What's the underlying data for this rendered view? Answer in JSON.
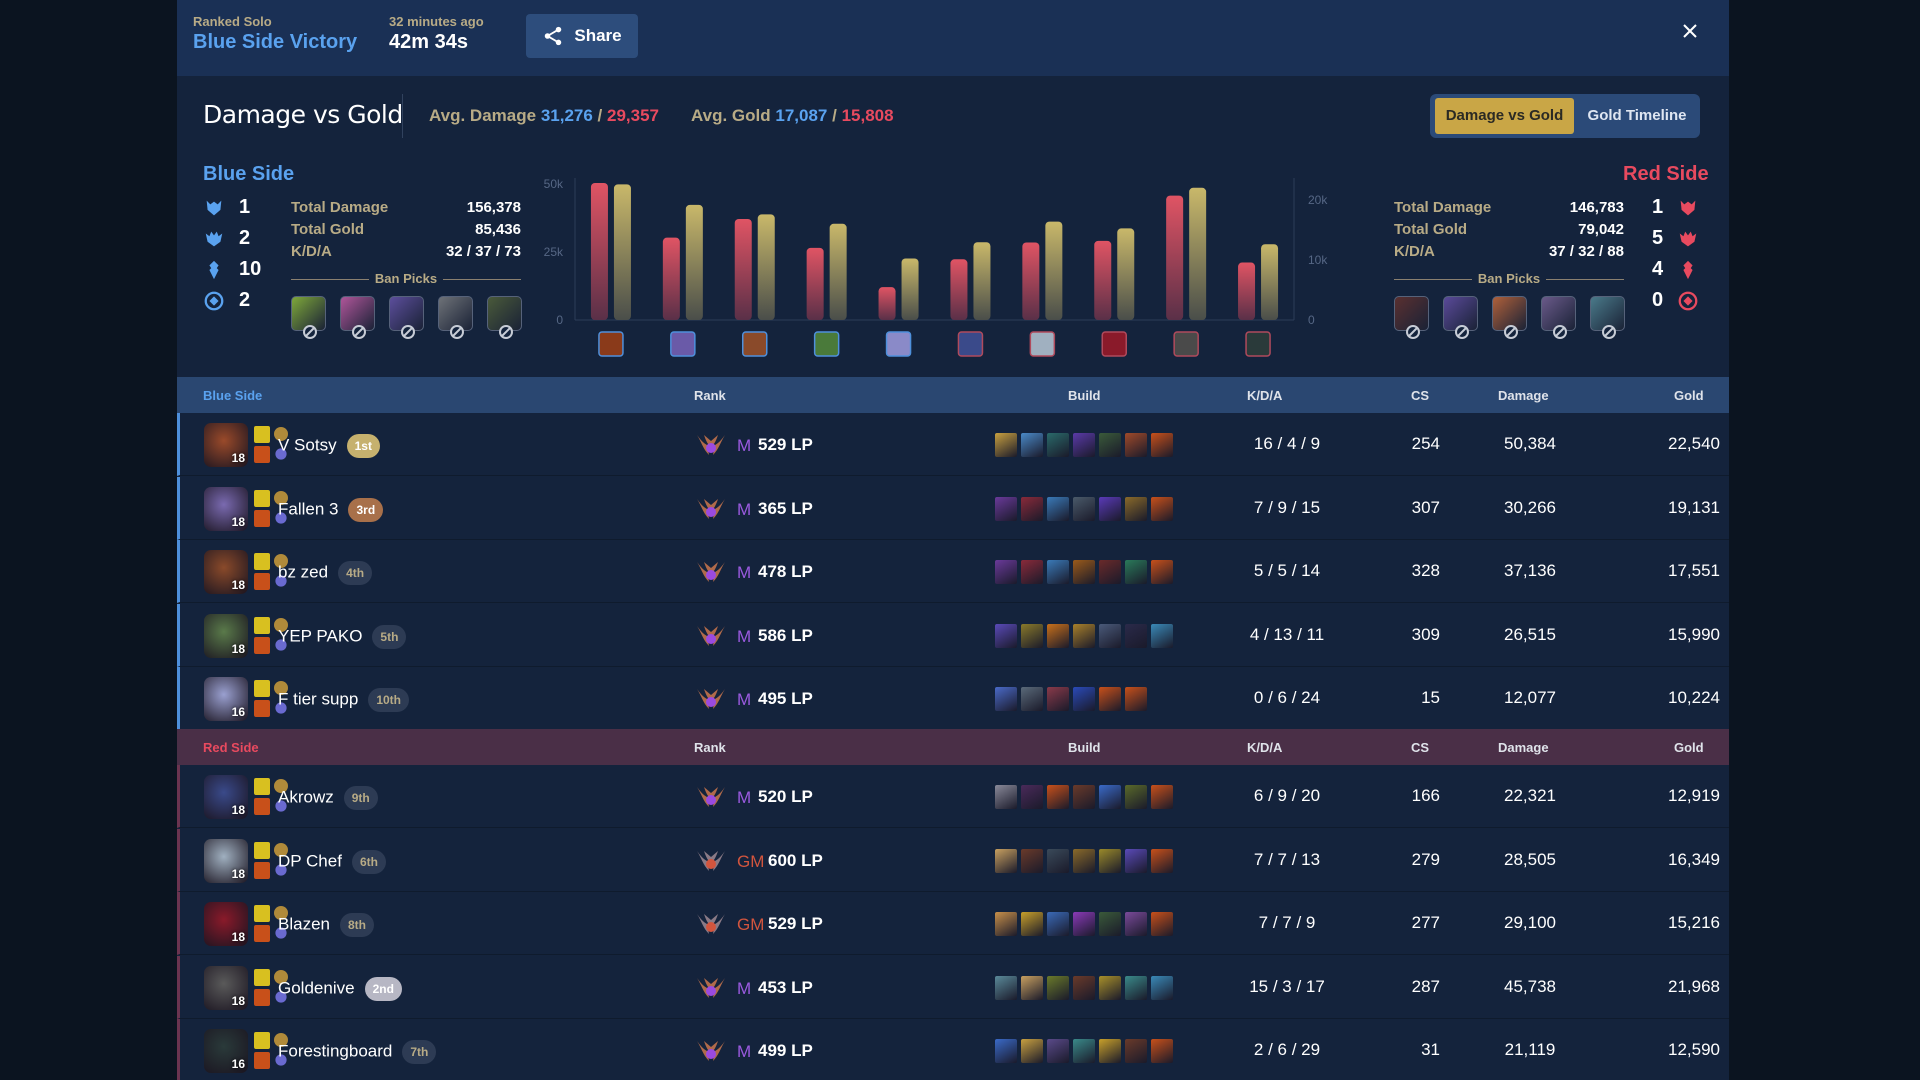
{
  "header": {
    "queue": "Ranked Solo",
    "result": "Blue Side Victory",
    "time_ago": "32 minutes ago",
    "duration": "42m 34s",
    "share_label": "Share",
    "close_icon": "close-icon"
  },
  "summary": {
    "title": "Damage vs Gold",
    "avg_damage_label": "Avg. Damage",
    "avg_damage_blue": "31,276",
    "avg_damage_red": "29,357",
    "avg_gold_label": "Avg. Gold",
    "avg_gold_blue": "17,087",
    "avg_gold_red": "15,808",
    "separator": "/",
    "toggle": [
      "Damage vs Gold",
      "Gold Timeline"
    ],
    "toggle_active": "Damage vs Gold"
  },
  "blue": {
    "title": "Blue Side",
    "objectives": [
      {
        "icon": "baron-icon",
        "value": "1"
      },
      {
        "icon": "dragon-icon",
        "value": "2"
      },
      {
        "icon": "tower-icon",
        "value": "10"
      },
      {
        "icon": "herald-icon",
        "value": "2"
      }
    ],
    "stats": [
      {
        "label": "Total Damage",
        "value": "156,378"
      },
      {
        "label": "Total Gold",
        "value": "85,436"
      },
      {
        "label": "K/D/A",
        "value": "32 / 37 / 73"
      }
    ],
    "ban_label": "Ban Picks",
    "bans": [
      "#7fa83a",
      "#b0569a",
      "#5c4e9c",
      "#6e7278",
      "#4a5a3a"
    ]
  },
  "red": {
    "title": "Red Side",
    "objectives": [
      {
        "icon": "baron-icon",
        "value": "1"
      },
      {
        "icon": "dragon-icon",
        "value": "5"
      },
      {
        "icon": "tower-icon",
        "value": "4"
      },
      {
        "icon": "herald-icon",
        "value": "0"
      }
    ],
    "stats": [
      {
        "label": "Total Damage",
        "value": "146,783"
      },
      {
        "label": "Total Gold",
        "value": "79,042"
      },
      {
        "label": "K/D/A",
        "value": "37 / 32 / 88"
      }
    ],
    "ban_label": "Ban Picks",
    "bans": [
      "#5a3030",
      "#5a4a9a",
      "#b0603a",
      "#6a5a8a",
      "#4a7a8a"
    ]
  },
  "colors": {
    "blue": "#5aa2ef",
    "red": "#e84a5f",
    "gold": "#c9a646",
    "damage_bar": "#e05464",
    "gold_bar": "#c9b86a"
  },
  "chart_data": {
    "type": "bar",
    "title": "Damage vs Gold",
    "categories": [
      "V Sotsy",
      "Fallen 3",
      "bz zed",
      "YEP PAKO",
      "F tier supp",
      "Akrowz",
      "DP Chef",
      "Blazen",
      "Goldenive",
      "Forestingboard"
    ],
    "category_sides": [
      "blue",
      "blue",
      "blue",
      "blue",
      "blue",
      "red",
      "red",
      "red",
      "red",
      "red"
    ],
    "series": [
      {
        "name": "Damage",
        "axis": "left",
        "values": [
          50384,
          30266,
          37136,
          26515,
          12077,
          22321,
          28505,
          29100,
          45738,
          21119
        ]
      },
      {
        "name": "Gold",
        "axis": "right",
        "values": [
          22540,
          19131,
          17551,
          15990,
          10224,
          12919,
          16349,
          15216,
          21968,
          12590
        ]
      }
    ],
    "left_axis": {
      "ticks": [
        "0",
        "25k",
        "50k"
      ],
      "range": [
        0,
        50000
      ]
    },
    "right_axis": {
      "ticks": [
        "0",
        "10k",
        "20k"
      ],
      "range": [
        0,
        22600
      ]
    },
    "grid": false,
    "legend": "none"
  },
  "table": {
    "columns": {
      "rank": "Rank",
      "build": "Build",
      "kda": "K/D/A",
      "cs": "CS",
      "damage": "Damage",
      "gold": "Gold"
    },
    "blue_label": "Blue Side",
    "red_label": "Red Side",
    "blue_players": [
      {
        "name": "V Sotsy",
        "place": "1st",
        "place_class": "p1",
        "level": "18",
        "tier": "M",
        "lp": "529 LP",
        "kda": "16 / 4 / 9",
        "cs": "254",
        "damage": "50,384",
        "gold": "22,540",
        "champ_color": "#9a4a2a",
        "items": [
          "#c8a040",
          "#4a8ac8",
          "#2a6a6a",
          "#5a3aa8",
          "#3a5a3a",
          "#a04a2a",
          "#c8501a"
        ]
      },
      {
        "name": "Fallen 3",
        "place": "3rd",
        "place_class": "p3",
        "level": "18",
        "tier": "M",
        "lp": "365 LP",
        "kda": "7 / 9 / 15",
        "cs": "307",
        "damage": "30,266",
        "gold": "19,131",
        "champ_color": "#7a6ab0",
        "items": [
          "#6a3a9a",
          "#8a2a3a",
          "#3a7ab8",
          "#4a5a6a",
          "#5a3ab8",
          "#8a6a2a",
          "#c8501a"
        ]
      },
      {
        "name": "bz zed",
        "place": "4th",
        "place_class": "pn",
        "level": "18",
        "tier": "M",
        "lp": "478 LP",
        "kda": "5 / 5 / 14",
        "cs": "328",
        "damage": "37,136",
        "gold": "17,551",
        "champ_color": "#8a4a2a",
        "items": [
          "#6a3a9a",
          "#8a2a3a",
          "#3a7ab8",
          "#9a5a1a",
          "#6a2a2a",
          "#2a7a5a",
          "#c8501a"
        ]
      },
      {
        "name": "YEP PAKO",
        "place": "5th",
        "place_class": "pn",
        "level": "18",
        "tier": "M",
        "lp": "586 LP",
        "kda": "4 / 13 / 11",
        "cs": "309",
        "damage": "26,515",
        "gold": "15,990",
        "champ_color": "#5a7a4a",
        "items": [
          "#5a4ab8",
          "#8a7a2a",
          "#c8701a",
          "#a8802a",
          "#4a5a7a",
          "#2a2a4a",
          "#3a8ab8"
        ]
      },
      {
        "name": "F tier supp",
        "place": "10th",
        "place_class": "pn",
        "level": "16",
        "tier": "M",
        "lp": "495 LP",
        "kda": "0 / 6 / 24",
        "cs": "15",
        "damage": "12,077",
        "gold": "10,224",
        "champ_color": "#9aa0d0",
        "items": [
          "#4a6ac8",
          "#5a6a7a",
          "#8a3a4a",
          "#2a4ab8",
          "#c8501a",
          "#c8501a"
        ]
      }
    ],
    "red_players": [
      {
        "name": "Akrowz",
        "place": "9th",
        "place_class": "pn",
        "level": "18",
        "tier": "M",
        "lp": "520 LP",
        "kda": "6 / 9 / 20",
        "cs": "166",
        "damage": "22,321",
        "gold": "12,919",
        "champ_color": "#3a4a8a",
        "items": [
          "#8a8a9a",
          "#4a2a5a",
          "#c8501a",
          "#6a3a2a",
          "#3a6ac8",
          "#5a6a2a",
          "#c8501a"
        ]
      },
      {
        "name": "DP Chef",
        "place": "6th",
        "place_class": "pn",
        "level": "18",
        "tier": "GM",
        "lp": "600 LP",
        "kda": "7 / 7 / 13",
        "cs": "279",
        "damage": "28,505",
        "gold": "16,349",
        "champ_color": "#a0b0c0",
        "items": [
          "#c8a060",
          "#6a3a2a",
          "#3a4a5a",
          "#8a6a2a",
          "#9a8a2a",
          "#5a4ab8",
          "#c8501a"
        ]
      },
      {
        "name": "Blazen",
        "place": "8th",
        "place_class": "pn",
        "level": "18",
        "tier": "GM",
        "lp": "529 LP",
        "kda": "7 / 7 / 9",
        "cs": "277",
        "damage": "29,100",
        "gold": "15,216",
        "champ_color": "#8a1a2a",
        "items": [
          "#c8904a",
          "#c8a02a",
          "#3a6ab8",
          "#8a3ab8",
          "#3a5a3a",
          "#7a4a9a",
          "#c8501a"
        ]
      },
      {
        "name": "Goldenive",
        "place": "2nd",
        "place_class": "p2",
        "level": "18",
        "tier": "M",
        "lp": "453 LP",
        "kda": "15 / 3 / 17",
        "cs": "287",
        "damage": "45,738",
        "gold": "21,968",
        "champ_color": "#5a5a5a",
        "items": [
          "#5a8a9a",
          "#c8a060",
          "#6a7a2a",
          "#6a3a2a",
          "#a8902a",
          "#3a8a8a",
          "#3a8ab8"
        ]
      },
      {
        "name": "Forestingboard",
        "place": "7th",
        "place_class": "pn",
        "level": "16",
        "tier": "M",
        "lp": "499 LP",
        "kda": "2 / 6 / 29",
        "cs": "31",
        "damage": "21,119",
        "gold": "12,590",
        "champ_color": "#2a3a3a",
        "items": [
          "#3a6ac8",
          "#c8a040",
          "#5a4a8a",
          "#3a8a8a",
          "#c8a02a",
          "#6a3a2a",
          "#c8501a"
        ]
      }
    ]
  }
}
